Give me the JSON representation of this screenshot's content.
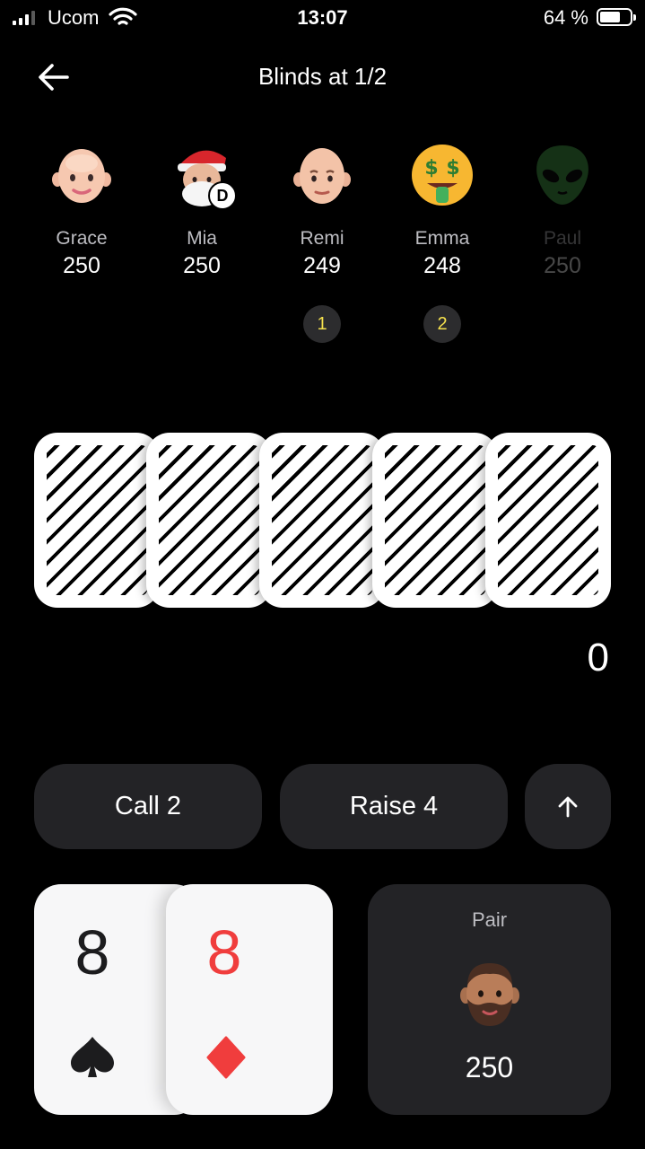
{
  "status_bar": {
    "carrier": "Ucom",
    "time": "13:07",
    "battery": "64 %",
    "battery_level": 0.64,
    "icons": [
      "signal-icon",
      "wifi-icon",
      "battery-icon"
    ]
  },
  "header": {
    "back_icon": "back-arrow-icon",
    "title": "Blinds at 1/2"
  },
  "players": [
    {
      "name": "Grace",
      "stack": "250",
      "avatar": "bald-woman-memoji"
    },
    {
      "name": "Mia",
      "stack": "250",
      "avatar": "santa-memoji",
      "dealer": "D"
    },
    {
      "name": "Remi",
      "stack": "249",
      "avatar": "bald-man-memoji",
      "blind": "1"
    },
    {
      "name": "Emma",
      "stack": "248",
      "avatar": "money-mouth-emoji",
      "blind": "2"
    },
    {
      "name": "Paul",
      "stack": "250",
      "avatar": "alien-emoji",
      "inactive": true
    }
  ],
  "board": {
    "cards": [
      "face-down",
      "face-down",
      "face-down",
      "face-down",
      "face-down"
    ],
    "pot": "0"
  },
  "actions": {
    "call_label": "Call 2",
    "raise_label": "Raise 4",
    "expand_icon": "arrow-up-icon"
  },
  "hand": {
    "cards": [
      {
        "rank": "8",
        "suit": "spade",
        "color": "#1c1c1e"
      },
      {
        "rank": "8",
        "suit": "diamond",
        "color": "#f03d3d"
      }
    ],
    "hand_name": "Pair",
    "stack": "250",
    "avatar": "bearded-man-memoji"
  },
  "colors": {
    "background": "#000000",
    "button_bg": "#232326",
    "blind_chip_text": "#f4e04d",
    "red_suit": "#f03d3d"
  }
}
